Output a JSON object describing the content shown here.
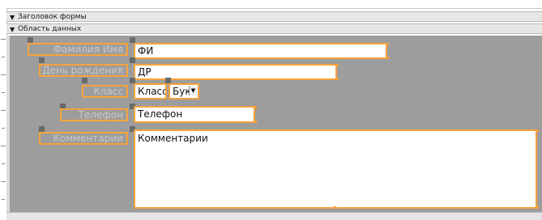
{
  "sections": {
    "form_header": "Заголовок формы",
    "data_area": "Область данных"
  },
  "section_arrow_icon": "triangle-down-icon",
  "colors": {
    "selection_border": "#f5a33b",
    "grid_background": "#9d9d9d",
    "handle": "#6a6a6a"
  },
  "controls": {
    "surname": {
      "label": "Фамилия Имя",
      "value": "ФИ"
    },
    "birthday": {
      "label": "День рождения",
      "value": "ДР"
    },
    "class": {
      "label": "Класс",
      "value": "Класс",
      "letter_value": "Бук"
    },
    "phone": {
      "label": "Телефон",
      "value": "Телефон"
    },
    "comments": {
      "label": "Комментарии",
      "value": "Комментарии"
    }
  }
}
